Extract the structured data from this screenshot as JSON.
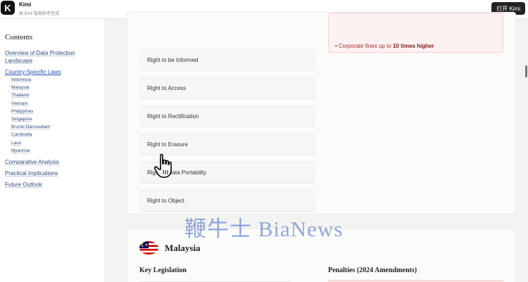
{
  "app": {
    "logo_letter": "K",
    "title": "Kimi",
    "subtitle": "由 Kimi 智能助手生成",
    "open_button": "打开 Kimi"
  },
  "toc": {
    "title": "Contents",
    "items": [
      "Overview of Data Protection",
      "Landscape",
      "Country-Specific Laws",
      "Comparative Analysis",
      "Practical Implications",
      "Future Outlook"
    ],
    "countries": [
      "Indonesia",
      "Malaysia",
      "Thailand",
      "Vietnam",
      "Philippines",
      "Singapore",
      "Brunei Darussalam",
      "Cambodia",
      "Laos",
      "Myanmar"
    ]
  },
  "rights": [
    "Right to be Informed",
    "Right to Access",
    "Right to Rectification",
    "Right to Erasure",
    "Right to Data Portability",
    "Right to Object"
  ],
  "penalty": {
    "prefix": "Corporate fines up to ",
    "bold": "10 times higher"
  },
  "section": {
    "country": "Malaysia",
    "key_legislation": "Key Legislation",
    "penalties": "Penalties (2024 Amendments)"
  },
  "watermark": "鞭牛士 BiaNews"
}
